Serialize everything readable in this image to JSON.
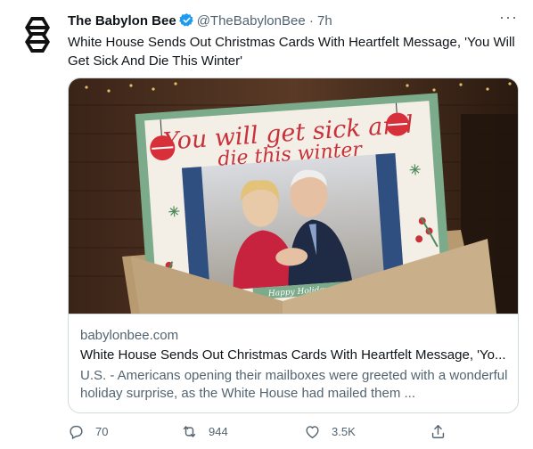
{
  "author": {
    "name": "The Babylon Bee",
    "handle": "@TheBabylonBee",
    "separator": "·",
    "time": "7h"
  },
  "more_label": "···",
  "tweet": {
    "text": "White House Sends Out Christmas Cards With Heartfelt Message, 'You Will Get Sick And Die This Winter'"
  },
  "card": {
    "image_headline_line1": "You will get sick and",
    "image_headline_line2": "die this winter",
    "image_footer": "Happy Holidays!",
    "domain": "babylonbee.com",
    "title": "White House Sends Out Christmas Cards With Heartfelt Message, 'Yo...",
    "description": "U.S. - Americans opening their mailboxes were greeted with a wonderful holiday surprise, as the White House had mailed them ..."
  },
  "actions": {
    "reply_count": "70",
    "retweet_count": "944",
    "like_count": "3.5K"
  },
  "colors": {
    "accent": "#1d9bf0",
    "card_green": "#7bab8a",
    "card_red": "#c8303a",
    "envelope": "#c9b08a"
  },
  "icons": [
    "bee-logo-icon",
    "verified-badge-icon",
    "more-icon",
    "reply-icon",
    "retweet-icon",
    "like-icon",
    "share-icon"
  ]
}
